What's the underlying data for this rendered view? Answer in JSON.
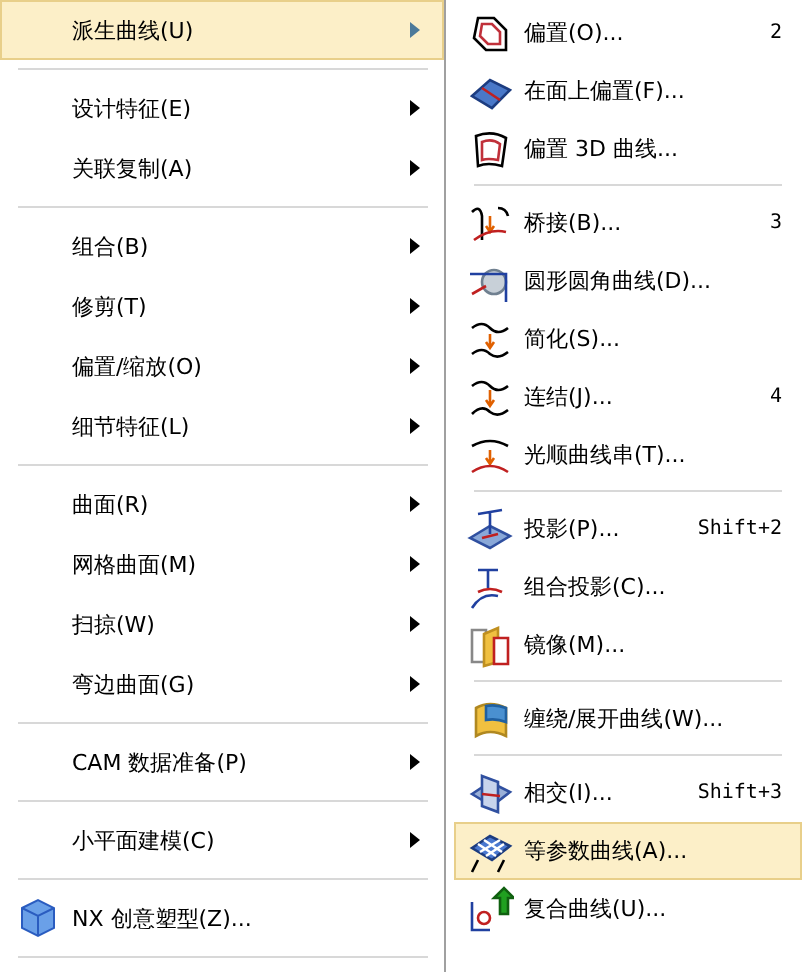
{
  "main_menu": {
    "items": [
      {
        "kind": "item",
        "label": "派生曲线(U)",
        "submenu": true,
        "selected": true
      },
      {
        "kind": "separator"
      },
      {
        "kind": "item",
        "label": "设计特征(E)",
        "submenu": true,
        "selected": false
      },
      {
        "kind": "item",
        "label": "关联复制(A)",
        "submenu": true,
        "selected": false
      },
      {
        "kind": "separator"
      },
      {
        "kind": "item",
        "label": "组合(B)",
        "submenu": true,
        "selected": false
      },
      {
        "kind": "item",
        "label": "修剪(T)",
        "submenu": true,
        "selected": false
      },
      {
        "kind": "item",
        "label": "偏置/缩放(O)",
        "submenu": true,
        "selected": false
      },
      {
        "kind": "item",
        "label": "细节特征(L)",
        "submenu": true,
        "selected": false
      },
      {
        "kind": "separator"
      },
      {
        "kind": "item",
        "label": "曲面(R)",
        "submenu": true,
        "selected": false
      },
      {
        "kind": "item",
        "label": "网格曲面(M)",
        "submenu": true,
        "selected": false
      },
      {
        "kind": "item",
        "label": "扫掠(W)",
        "submenu": true,
        "selected": false
      },
      {
        "kind": "item",
        "label": "弯边曲面(G)",
        "submenu": true,
        "selected": false
      },
      {
        "kind": "separator"
      },
      {
        "kind": "item",
        "label": "CAM 数据准备(P)",
        "submenu": true,
        "selected": false
      },
      {
        "kind": "separator"
      },
      {
        "kind": "item",
        "label": "小平面建模(C)",
        "submenu": true,
        "selected": false
      },
      {
        "kind": "separator"
      },
      {
        "kind": "item",
        "label": "NX 创意塑型(Z)...",
        "submenu": false,
        "selected": false
      },
      {
        "kind": "separator"
      }
    ]
  },
  "submenu": {
    "items": [
      {
        "kind": "item",
        "label": "偏置(O)...",
        "shortcut": "2",
        "selected": false
      },
      {
        "kind": "item",
        "label": "在面上偏置(F)...",
        "selected": false
      },
      {
        "kind": "item",
        "label": "偏置 3D 曲线...",
        "selected": false
      },
      {
        "kind": "separator"
      },
      {
        "kind": "item",
        "label": "桥接(B)...",
        "shortcut": "3",
        "selected": false
      },
      {
        "kind": "item",
        "label": "圆形圆角曲线(D)...",
        "selected": false
      },
      {
        "kind": "item",
        "label": "简化(S)...",
        "selected": false
      },
      {
        "kind": "item",
        "label": "连结(J)...",
        "shortcut": "4",
        "selected": false
      },
      {
        "kind": "item",
        "label": "光顺曲线串(T)...",
        "selected": false
      },
      {
        "kind": "separator"
      },
      {
        "kind": "item",
        "label": "投影(P)...",
        "shortcut": "Shift+2",
        "selected": false
      },
      {
        "kind": "item",
        "label": "组合投影(C)...",
        "selected": false
      },
      {
        "kind": "item",
        "label": "镜像(M)...",
        "selected": false
      },
      {
        "kind": "separator"
      },
      {
        "kind": "item",
        "label": "缠绕/展开曲线(W)...",
        "selected": false
      },
      {
        "kind": "separator"
      },
      {
        "kind": "item",
        "label": "相交(I)...",
        "shortcut": "Shift+3",
        "selected": false
      },
      {
        "kind": "item",
        "label": "等参数曲线(A)...",
        "selected": true
      },
      {
        "kind": "item",
        "label": "复合曲线(U)...",
        "selected": false
      }
    ]
  }
}
